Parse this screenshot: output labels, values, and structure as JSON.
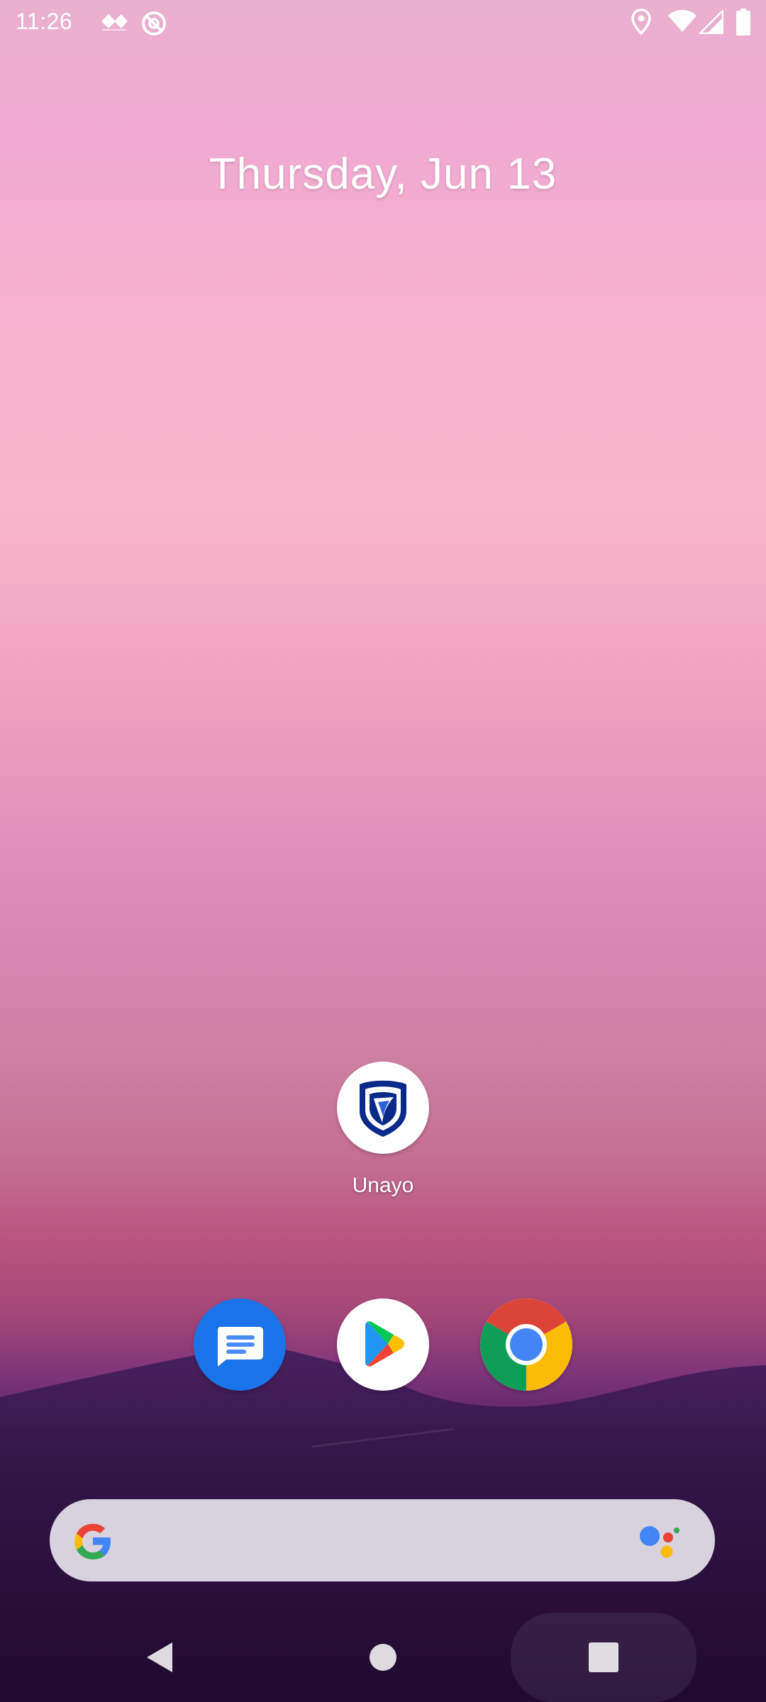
{
  "status_bar": {
    "time": "11:26",
    "left_icons": [
      "cards-icon",
      "no-signal-circle-icon"
    ],
    "right_icons": [
      "location-icon",
      "wifi-icon",
      "cellular-signal-icon",
      "battery-icon"
    ]
  },
  "home": {
    "date": "Thursday, Jun 13",
    "apps": [
      {
        "label": "Unayo",
        "icon": "standard-bank-shield-icon"
      }
    ],
    "dock": [
      {
        "icon": "messages-icon",
        "color": "#1a73e8"
      },
      {
        "icon": "play-store-icon",
        "color": "#ffffff"
      },
      {
        "icon": "chrome-icon",
        "color": "#ffffff"
      }
    ],
    "search": {
      "left_icon": "google-g-icon",
      "right_icon": "google-assistant-icon",
      "background": "#d8d1de"
    }
  },
  "nav": {
    "buttons": [
      "back-button",
      "home-button",
      "recents-button"
    ]
  }
}
